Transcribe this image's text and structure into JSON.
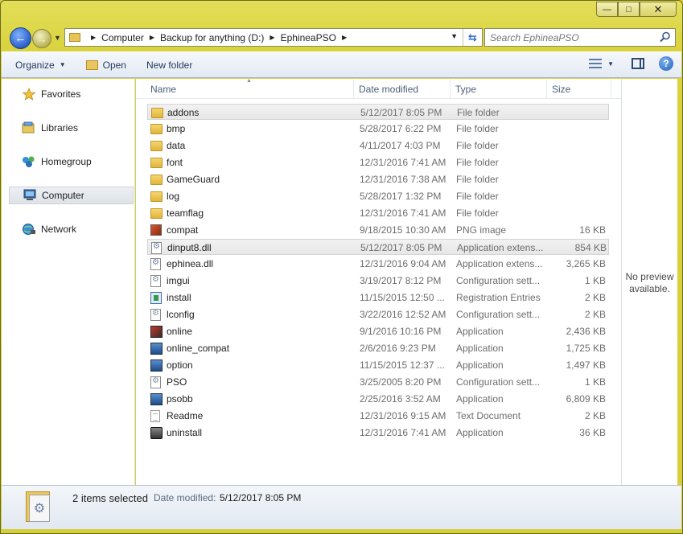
{
  "window": {
    "minimize": "—",
    "maximize": "□",
    "close": "✕"
  },
  "nav": {
    "back": "←",
    "forward": "→",
    "breadcrumbs": [
      "Computer",
      "Backup for anything (D:)",
      "EphineaPSO"
    ],
    "search_placeholder": "Search EphineaPSO"
  },
  "toolbar": {
    "organize": "Organize",
    "open": "Open",
    "new_folder": "New folder",
    "help": "?"
  },
  "sidebar": {
    "items": [
      {
        "label": "Favorites",
        "icon": "star-icon"
      },
      {
        "label": "Libraries",
        "icon": "libraries-icon"
      },
      {
        "label": "Homegroup",
        "icon": "homegroup-icon"
      },
      {
        "label": "Computer",
        "icon": "computer-icon",
        "selected": true
      },
      {
        "label": "Network",
        "icon": "network-icon"
      }
    ]
  },
  "columns": {
    "name": "Name",
    "date": "Date modified",
    "type": "Type",
    "size": "Size"
  },
  "files": [
    {
      "name": "addons",
      "date": "5/12/2017 8:05 PM",
      "type": "File folder",
      "size": "",
      "icon": "folder",
      "selected": true
    },
    {
      "name": "bmp",
      "date": "5/28/2017 6:22 PM",
      "type": "File folder",
      "size": "",
      "icon": "folder"
    },
    {
      "name": "data",
      "date": "4/11/2017 4:03 PM",
      "type": "File folder",
      "size": "",
      "icon": "folder"
    },
    {
      "name": "font",
      "date": "12/31/2016 7:41 AM",
      "type": "File folder",
      "size": "",
      "icon": "folder"
    },
    {
      "name": "GameGuard",
      "date": "12/31/2016 7:38 AM",
      "type": "File folder",
      "size": "",
      "icon": "folder"
    },
    {
      "name": "log",
      "date": "5/28/2017 1:32 PM",
      "type": "File folder",
      "size": "",
      "icon": "folder"
    },
    {
      "name": "teamflag",
      "date": "12/31/2016 7:41 AM",
      "type": "File folder",
      "size": "",
      "icon": "folder"
    },
    {
      "name": "compat",
      "date": "9/18/2015 10:30 AM",
      "type": "PNG image",
      "size": "16 KB",
      "icon": "png"
    },
    {
      "name": "dinput8.dll",
      "date": "5/12/2017 8:05 PM",
      "type": "Application extens...",
      "size": "854 KB",
      "icon": "dll",
      "selected": true
    },
    {
      "name": "ephinea.dll",
      "date": "12/31/2016 9:04 AM",
      "type": "Application extens...",
      "size": "3,265 KB",
      "icon": "dll"
    },
    {
      "name": "imgui",
      "date": "3/19/2017 8:12 PM",
      "type": "Configuration sett...",
      "size": "1 KB",
      "icon": "cfg"
    },
    {
      "name": "install",
      "date": "11/15/2015 12:50 ...",
      "type": "Registration Entries",
      "size": "2 KB",
      "icon": "reg"
    },
    {
      "name": "lconfig",
      "date": "3/22/2016 12:52 AM",
      "type": "Configuration sett...",
      "size": "2 KB",
      "icon": "cfg"
    },
    {
      "name": "online",
      "date": "9/1/2016 10:16 PM",
      "type": "Application",
      "size": "2,436 KB",
      "icon": "red"
    },
    {
      "name": "online_compat",
      "date": "2/6/2016 9:23 PM",
      "type": "Application",
      "size": "1,725 KB",
      "icon": "app"
    },
    {
      "name": "option",
      "date": "11/15/2015 12:37 ...",
      "type": "Application",
      "size": "1,497 KB",
      "icon": "app"
    },
    {
      "name": "PSO",
      "date": "3/25/2005 8:20 PM",
      "type": "Configuration sett...",
      "size": "1 KB",
      "icon": "cfg"
    },
    {
      "name": "psobb",
      "date": "2/25/2016 3:52 AM",
      "type": "Application",
      "size": "6,809 KB",
      "icon": "app"
    },
    {
      "name": "Readme",
      "date": "12/31/2016 9:15 AM",
      "type": "Text Document",
      "size": "2 KB",
      "icon": "txt"
    },
    {
      "name": "uninstall",
      "date": "12/31/2016 7:41 AM",
      "type": "Application",
      "size": "36 KB",
      "icon": "uninst"
    }
  ],
  "preview": {
    "text": "No preview available."
  },
  "details": {
    "selection": "2 items selected",
    "date_label": "Date modified:",
    "date_value": "5/12/2017 8:05 PM"
  }
}
